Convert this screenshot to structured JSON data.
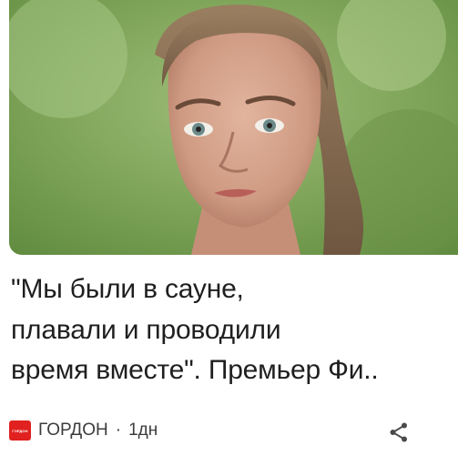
{
  "article": {
    "image_alt": "Portrait of a woman with hair pulled back against a green background",
    "headline_lines": [
      "\"Мы были в сауне,",
      "плавали и проводили",
      "время вместе\". Премьер Фи.."
    ],
    "source": {
      "logo_text": "ГОРДОН",
      "logo_color": "#e0211f",
      "name": "ГОРДОН",
      "separator": "·",
      "age": "1дн"
    },
    "share_icon": "share-icon"
  }
}
